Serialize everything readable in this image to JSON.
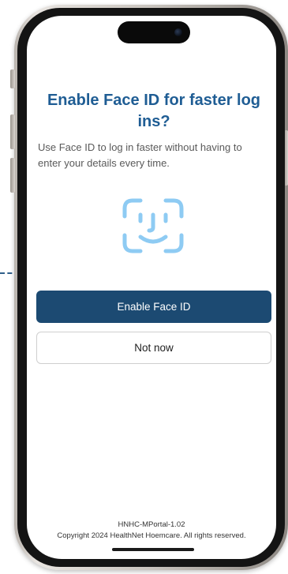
{
  "screen": {
    "title": "Enable Face ID for faster log ins?",
    "description": "Use Face ID to log in faster without having to enter your details every time.",
    "face_icon": "face-id-icon",
    "enable_button_label": "Enable Face ID",
    "not_now_button_label": "Not now",
    "version": "HNHC-MPortal-1.02",
    "copyright": "Copyright 2024 HealthNet Hoemcare. All rights reserved."
  },
  "colors": {
    "title": "#1f5d94",
    "primary_button": "#1c4a72",
    "face_icon": "#8ecbf3"
  }
}
